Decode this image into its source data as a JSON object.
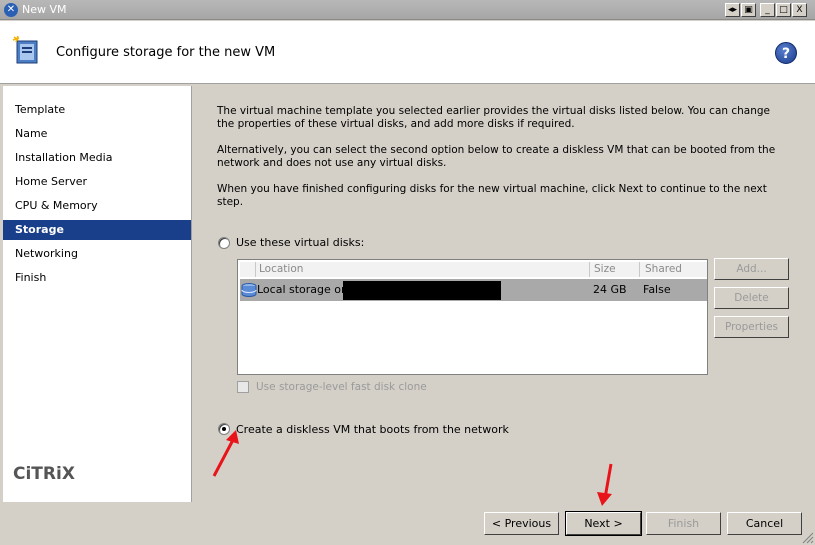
{
  "window": {
    "title": "New VM",
    "buttons": [
      "◂▸",
      "▣",
      "_",
      "□",
      "X"
    ]
  },
  "header": {
    "title": "Configure storage for the new VM",
    "help": "?"
  },
  "sidebar": {
    "items": [
      {
        "label": "Template"
      },
      {
        "label": "Name"
      },
      {
        "label": "Installation Media"
      },
      {
        "label": "Home Server"
      },
      {
        "label": "CPU & Memory"
      },
      {
        "label": "Storage"
      },
      {
        "label": "Networking"
      },
      {
        "label": "Finish"
      }
    ],
    "active_index": 5,
    "logo": "CiTRiX"
  },
  "main": {
    "paragraphs": [
      "The virtual machine template you selected earlier provides the virtual disks listed below. You can change the properties of these virtual disks, and add more disks if required.",
      "Alternatively, you can select the second option below to create a diskless VM that can be booted from the network and does not use any virtual disks.",
      "When you have finished configuring disks for the new virtual machine, click Next to continue to the next step."
    ],
    "option_disks": {
      "label": "Use these virtual disks:",
      "checked": false
    },
    "table": {
      "columns": [
        "Location",
        "Size",
        "Shared"
      ],
      "rows": [
        {
          "location": "Local storage on",
          "size": "24 GB",
          "shared": "False"
        }
      ]
    },
    "table_buttons": {
      "add": "Add...",
      "delete": "Delete",
      "properties": "Properties"
    },
    "fast_clone": {
      "label": "Use storage-level fast disk clone",
      "checked": false
    },
    "option_diskless": {
      "label": "Create a diskless VM that boots from the network",
      "checked": true
    }
  },
  "footer": {
    "previous": "< Previous",
    "next": "Next >",
    "finish": "Finish",
    "cancel": "Cancel"
  },
  "colors": {
    "selection": "#1a3f8a",
    "annotation_arrow": "#e8141a"
  }
}
